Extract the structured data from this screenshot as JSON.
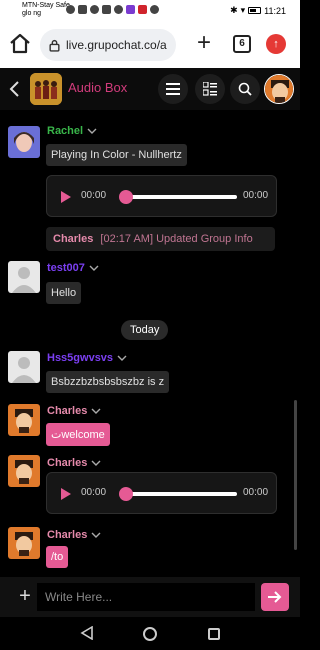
{
  "status_bar": {
    "carrier_line1": "MTN-Stay Safe",
    "carrier_line2": "glo ng",
    "time": "11:21"
  },
  "browser": {
    "url": "live.grupochat.co/a",
    "tab_count": "6"
  },
  "header": {
    "room_title": "Audio Box"
  },
  "messages": [
    {
      "sender": "Rachel",
      "sender_color": "#39b54a",
      "text": "Playing In Color - Nullhertz"
    },
    {
      "audio": {
        "time_start": "00:00",
        "time_end": "00:00",
        "progress": 0
      }
    },
    {
      "system": {
        "name": "Charles",
        "text": "[02:17 AM] Updated Group Info"
      }
    },
    {
      "sender": "test007",
      "sender_color": "#7b3ff2",
      "text": "Hello"
    },
    {
      "day_separator": "Today"
    },
    {
      "sender": "Hss5gwvsvs",
      "sender_color": "#7b3ff2",
      "text": "Bsbzzbzbsbsbszbz is z"
    },
    {
      "sender": "Charles",
      "sender_color": "#e58aab",
      "text": "ت‌welcome"
    },
    {
      "sender": "Charles",
      "sender_color": "#e58aab",
      "audio": {
        "time_start": "00:00",
        "time_end": "00:00",
        "progress": 0
      }
    },
    {
      "sender": "Charles",
      "sender_color": "#e58aab",
      "text": "/to"
    }
  ],
  "composer": {
    "placeholder": "Write Here..."
  },
  "colors": {
    "accent": "#e55a94",
    "header_title": "#d23c7c"
  }
}
